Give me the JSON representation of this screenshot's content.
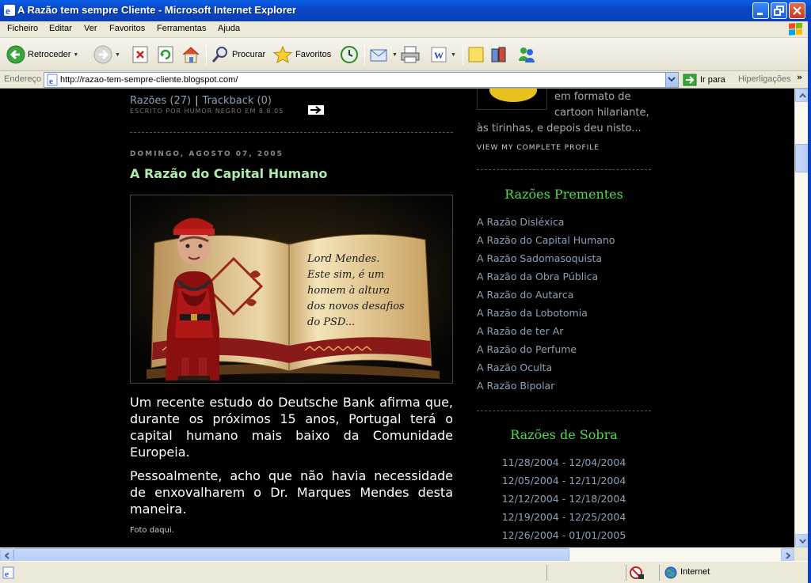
{
  "window": {
    "title": "A Razão tem sempre Cliente - Microsoft Internet Explorer"
  },
  "menu": {
    "items": [
      "Ficheiro",
      "Editar",
      "Ver",
      "Favoritos",
      "Ferramentas",
      "Ajuda"
    ]
  },
  "toolbar": {
    "back_label": "Retroceder",
    "search_label": "Procurar",
    "favorites_label": "Favoritos"
  },
  "address": {
    "label": "Endereço",
    "url": "http://razao-tem-sempre-cliente.blogspot.com/",
    "go_label": "Ir para",
    "links_label": "Hiperligações"
  },
  "prev_post": {
    "comments": "Razões (27)",
    "trackback": "Trackback (0)",
    "separator": "|",
    "byline": "ESCRITO POR HUMOR NEGRO EM 8.8.05"
  },
  "post": {
    "date": "DOMINGO, AGOSTO 07, 2005",
    "title": "A Razão do Capital Humano",
    "image_caption": [
      "Lord Mendes.",
      "Este sim, é um",
      "homem à altura",
      "dos novos desafios",
      "do PSD..."
    ],
    "paragraph1": "Um recente estudo do Deutsche Bank afirma que, durante os próximos 15 anos, Portugal terá o capital humano mais baixo da Comunidade Europeia.",
    "paragraph2": "Pessoalmente, acho que não havia necessidade de enxovalharem o Dr. Marques Mendes desta maneira.",
    "foto_link": "Foto daqui."
  },
  "profile": {
    "text_lines": [
      "em formato de",
      "cartoon hilariante,",
      "às tirinhas, e depois deu nisto..."
    ],
    "link": "VIEW MY COMPLETE PROFILE"
  },
  "recent": {
    "title": "Razões Prementes",
    "items": [
      "A Razão Disléxica",
      "A Razão do Capital Humano",
      "A Razão Sadomasoquista",
      "A Razão da Obra Pública",
      "A Razão do Autarca",
      "A Razão da Lobotomia",
      "A Razão de ter Ar",
      "A Razão do Perfume",
      "A Razão Oculta",
      "A Razão Bipolar"
    ]
  },
  "archives": {
    "title": "Razões de Sobra",
    "items": [
      "11/28/2004 - 12/04/2004",
      "12/05/2004 - 12/11/2004",
      "12/12/2004 - 12/18/2004",
      "12/19/2004 - 12/25/2004",
      "12/26/2004 - 01/01/2005"
    ]
  },
  "status": {
    "zone": "Internet"
  }
}
